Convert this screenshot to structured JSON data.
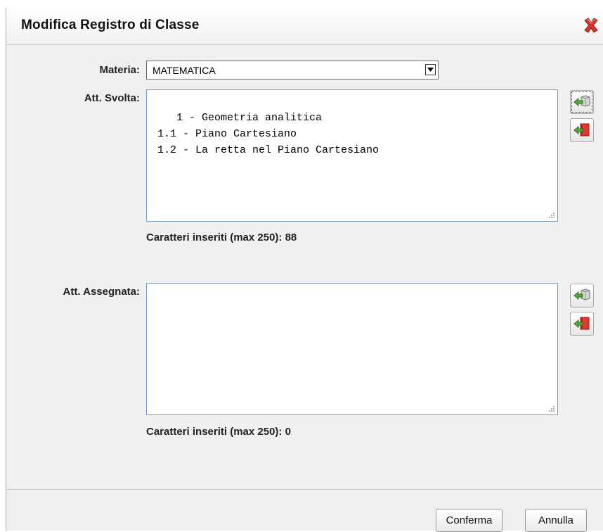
{
  "dialog": {
    "title": "Modifica Registro di Classe"
  },
  "form": {
    "materia_label": "Materia:",
    "materia_value": "MATEMATICA",
    "svolta_label": "Att. Svolta:",
    "svolta_text": "1 - Geometria analitica\n 1.1 - Piano Cartesiano\n 1.2 - La retta nel Piano Cartesiano",
    "svolta_counter": "Caratteri inseriti (max 250): 88",
    "assegnata_label": "Att. Assegnata:",
    "assegnata_text": "",
    "assegnata_counter": "Caratteri inseriti (max 250): 0"
  },
  "icons": {
    "close": "close-x-icon",
    "insert": "insert-from-box-icon",
    "clear": "remove-to-book-icon"
  },
  "footer": {
    "confirm_label": "Conferma",
    "cancel_label": "Annulla"
  }
}
